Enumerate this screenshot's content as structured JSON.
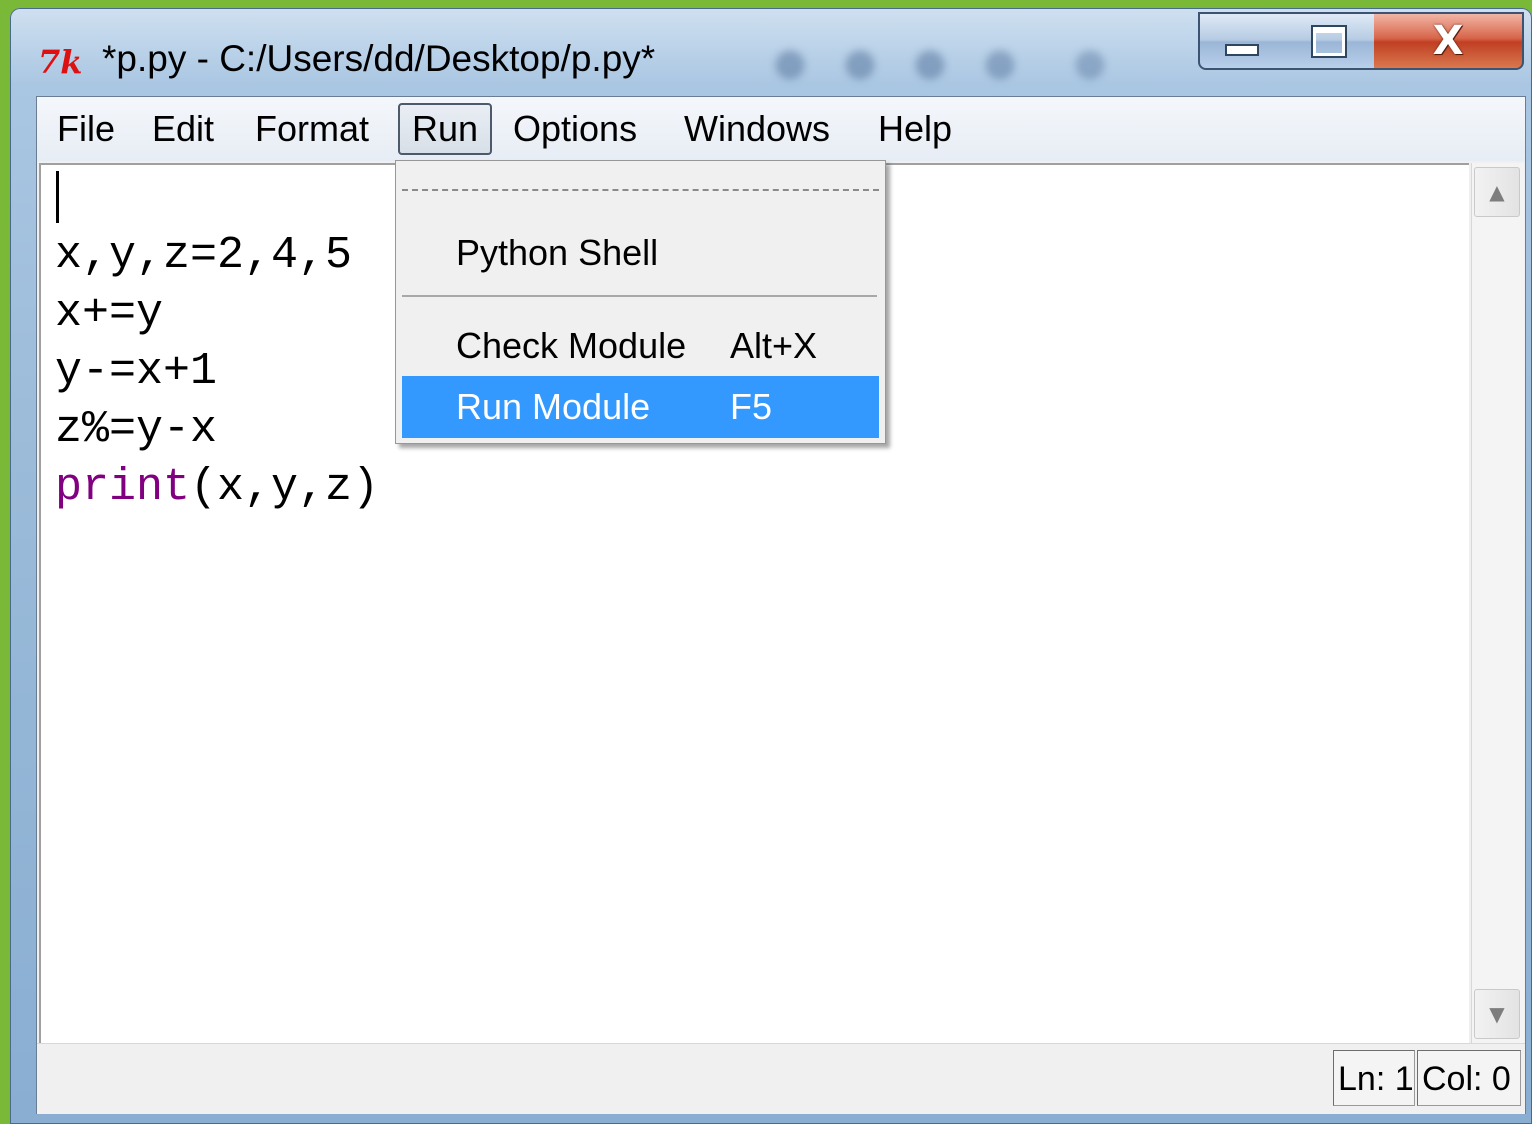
{
  "window": {
    "app_icon": "tk-feather-icon",
    "icon_text": "7k",
    "title": "*p.py - C:/Users/dd/Desktop/p.py*",
    "close_glyph": "X"
  },
  "menubar": {
    "items": [
      "File",
      "Edit",
      "Format",
      "Run",
      "Options",
      "Windows",
      "Help"
    ],
    "active": "Run"
  },
  "run_menu": {
    "items": [
      {
        "label": "Python Shell",
        "accel": ""
      },
      {
        "label": "Check Module",
        "accel": "Alt+X"
      },
      {
        "label": "Run Module",
        "accel": "F5",
        "highlighted": true
      }
    ]
  },
  "editor": {
    "lines": [
      {
        "text": "x,y,z=2,4,5"
      },
      {
        "text": "x+=y"
      },
      {
        "text": "y-=x+1"
      },
      {
        "text": "z%=y-x"
      },
      {
        "keyword": "print",
        "text": "(x,y,z)"
      }
    ]
  },
  "status": {
    "line": "Ln: 1",
    "col": "Col: 0"
  },
  "colors": {
    "keyword": "#800080",
    "highlight": "#3399ff",
    "desktop": "#7ab838",
    "close_button": "#c03f22"
  }
}
